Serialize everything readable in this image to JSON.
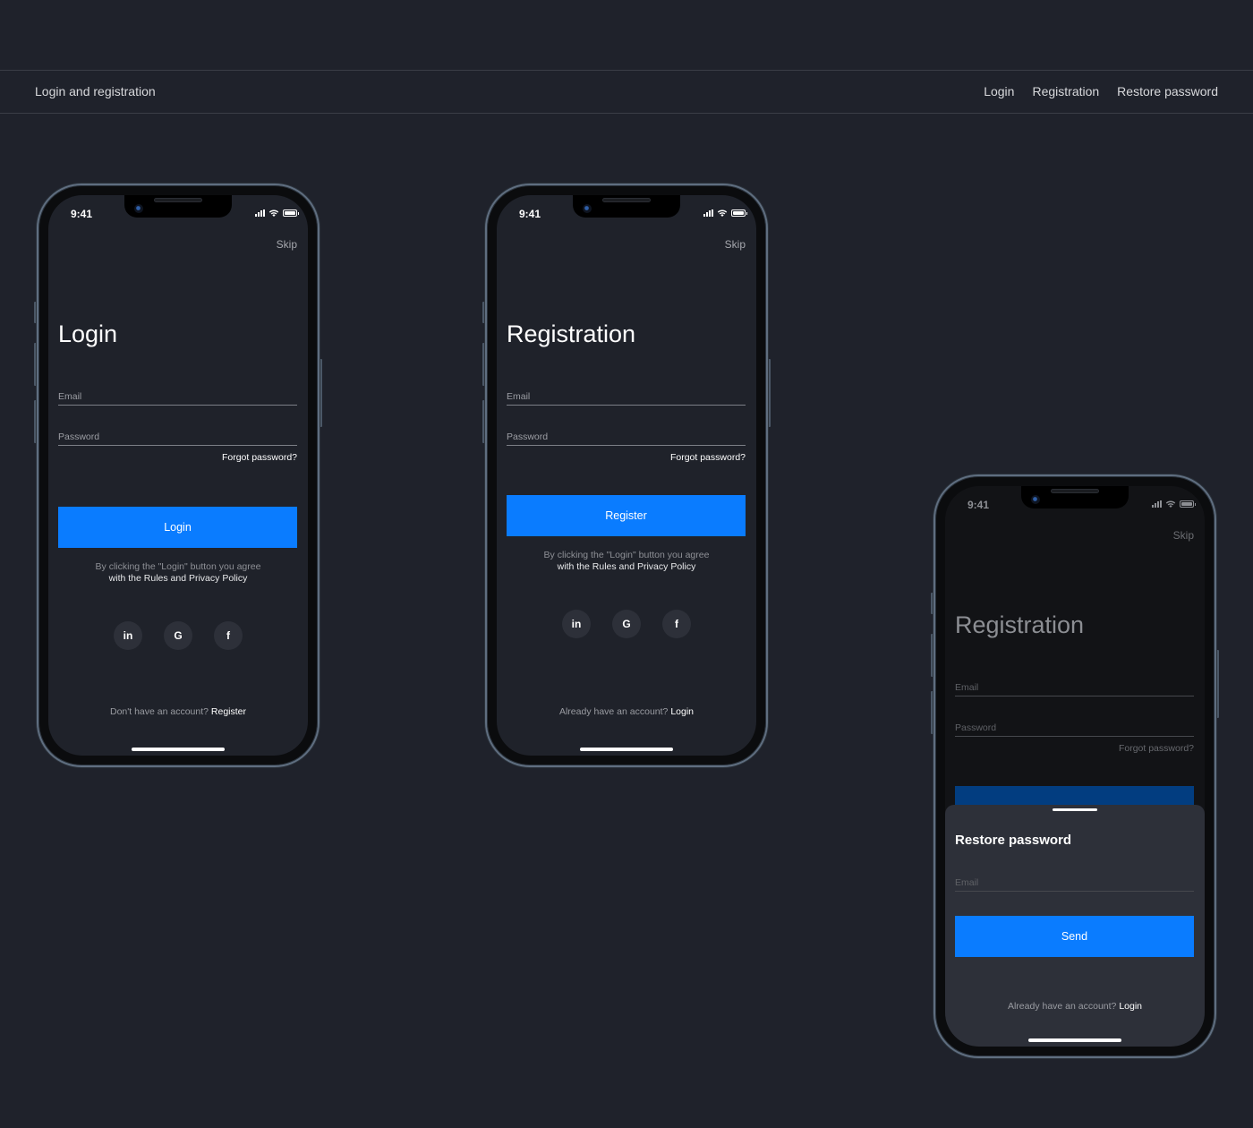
{
  "header": {
    "title": "Login and registration",
    "nav": [
      "Login",
      "Registration",
      "Restore password"
    ]
  },
  "status_bar": {
    "time": "9:41"
  },
  "colors": {
    "accent": "#0a7cff",
    "background": "#1f222b",
    "sheet": "#2d3039"
  },
  "screens": {
    "login": {
      "skip": "Skip",
      "title": "Login",
      "email_label": "Email",
      "password_label": "Password",
      "forgot": "Forgot password?",
      "button": "Login",
      "terms_line1": "By clicking the \"Login\" button you agree",
      "terms_line2": "with the Rules and Privacy Policy",
      "socials": [
        {
          "icon": "linkedin-icon",
          "glyph": "in"
        },
        {
          "icon": "google-icon",
          "glyph": "G"
        },
        {
          "icon": "facebook-icon",
          "glyph": "f"
        }
      ],
      "bottom_text": "Don't have an account?",
      "bottom_link": "Register"
    },
    "registration": {
      "skip": "Skip",
      "title": "Registration",
      "email_label": "Email",
      "password_label": "Password",
      "forgot": "Forgot password?",
      "button": "Register",
      "terms_line1": "By clicking the \"Login\" button you agree",
      "terms_line2": "with the Rules and Privacy Policy",
      "socials": [
        {
          "icon": "linkedin-icon",
          "glyph": "in"
        },
        {
          "icon": "google-icon",
          "glyph": "G"
        },
        {
          "icon": "facebook-icon",
          "glyph": "f"
        }
      ],
      "bottom_text": "Already have an account?",
      "bottom_link": "Login"
    },
    "restore": {
      "skip": "Skip",
      "background_title": "Registration",
      "email_label": "Email",
      "password_label": "Password",
      "forgot": "Forgot password?",
      "sheet_title": "Restore password",
      "sheet_email_label": "Email",
      "button": "Send",
      "bottom_text": "Already have an account?",
      "bottom_link": "Login"
    }
  }
}
